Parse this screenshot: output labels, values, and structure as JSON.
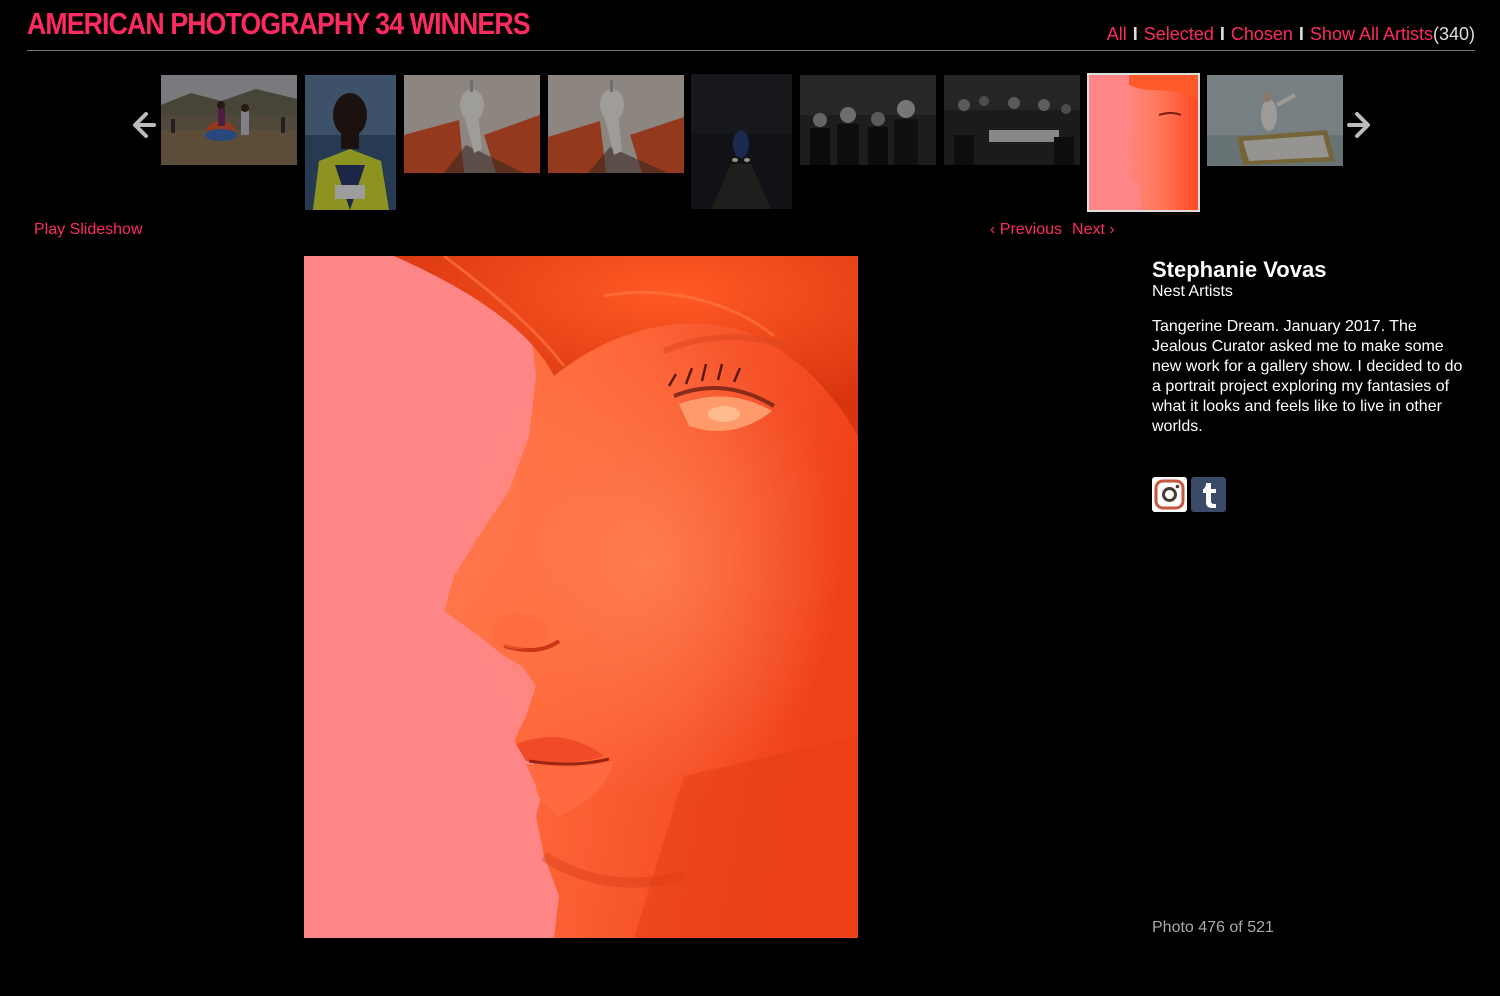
{
  "header": {
    "title": "AMERICAN PHOTOGRAPHY 34 WINNERS",
    "filters": {
      "all": "All",
      "selected": "Selected",
      "chosen": "Chosen",
      "show_all_artists": "Show All Artists",
      "artist_count": "(340)",
      "separator": "I"
    }
  },
  "strip": {
    "prev_icon": "arrow-left-icon",
    "next_icon": "arrow-right-icon",
    "thumbnails": [
      {
        "subject": "outdoor-market-dance"
      },
      {
        "subject": "marathon-runner"
      },
      {
        "subject": "white-shoe-still-life"
      },
      {
        "subject": "white-shoe-still-life-2"
      },
      {
        "subject": "night-scene-dark"
      },
      {
        "subject": "men-in-suits-bw"
      },
      {
        "subject": "banquet-bw"
      },
      {
        "subject": "red-portrait",
        "active": true
      },
      {
        "subject": "figure-on-rug"
      }
    ]
  },
  "controls": {
    "play_slideshow": "Play Slideshow",
    "previous": "‹ Previous",
    "next": "Next ›"
  },
  "info": {
    "artist_name": "Stephanie Vovas",
    "agency": "Nest Artists",
    "caption": "Tangerine Dream. January 2017. The Jealous Curator asked me to make some new work for a gallery show. I decided to do a portrait project exploring my fantasies of what it looks and feels like to live in other worlds.",
    "social": [
      "instagram-icon",
      "tumblr-icon"
    ],
    "counter": "Photo 476 of 521"
  },
  "colors": {
    "accent": "#ff2a5f",
    "background": "#000000",
    "text": "#ffffff",
    "muted": "#aaaaaa"
  }
}
